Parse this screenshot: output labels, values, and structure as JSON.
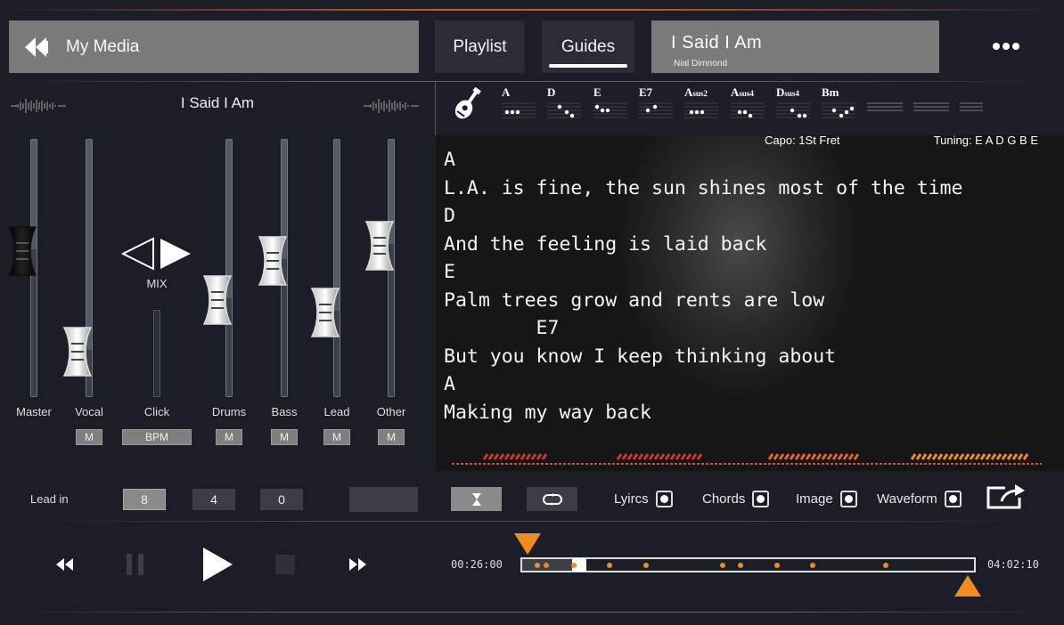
{
  "header": {
    "my_media_label": "My Media",
    "playlist_label": "Playlist",
    "guides_label": "Guides",
    "song_title": "I Said I Am",
    "song_artist": "Nial Dimnond",
    "more_icon": "more-dots-icon"
  },
  "mixer": {
    "title": "I Said I Am",
    "mix_label": "MIX",
    "channels": [
      {
        "name": "Master",
        "button": "",
        "level": 0.57
      },
      {
        "name": "Vocal",
        "button": "M",
        "level": 0.18
      },
      {
        "name": "Click",
        "button": "BPM",
        "level": null
      },
      {
        "name": "Drums",
        "button": "M",
        "level": 0.38
      },
      {
        "name": "Bass",
        "button": "M",
        "level": 0.53
      },
      {
        "name": "Lead",
        "button": "M",
        "level": 0.33
      },
      {
        "name": "Other",
        "button": "M",
        "level": 0.59
      }
    ]
  },
  "chords": {
    "list": [
      {
        "name": "A",
        "sub": ""
      },
      {
        "name": "D",
        "sub": ""
      },
      {
        "name": "E",
        "sub": ""
      },
      {
        "name": "E7",
        "sub": ""
      },
      {
        "name": "A",
        "sub": "sus2"
      },
      {
        "name": "A",
        "sub": "sus4"
      },
      {
        "name": "D",
        "sub": "sus4"
      },
      {
        "name": "Bm",
        "sub": ""
      }
    ],
    "capo": "Capo: 1St Fret",
    "tuning": "Tuning: E A D G B E"
  },
  "lyrics": {
    "lines": [
      "A",
      "L.A. is fine, the sun shines most of the time",
      "D",
      "And the feeling is laid back",
      "E",
      "Palm trees grow and rents are low",
      "        E7",
      "But you know I keep thinking about",
      "A",
      "Making my way back"
    ]
  },
  "controls": {
    "lead_in_label": "Lead in",
    "lead_in_values": [
      "8",
      "4",
      "0"
    ],
    "options": [
      {
        "label": "Lyircs",
        "checked": true
      },
      {
        "label": "Chords",
        "checked": true
      },
      {
        "label": "Image",
        "checked": true
      },
      {
        "label": "Waveform",
        "checked": true
      }
    ]
  },
  "transport": {
    "start_time": "00:26:00",
    "end_time": "04:02:10",
    "progress": 0.11,
    "loop_start": 0.0,
    "loop_end": 0.97,
    "accent_color": "#f08c1e"
  },
  "colors": {
    "accent": "#f08c1e",
    "header_button": "#7a7a7a",
    "stripe_red": "#c83a2a"
  }
}
